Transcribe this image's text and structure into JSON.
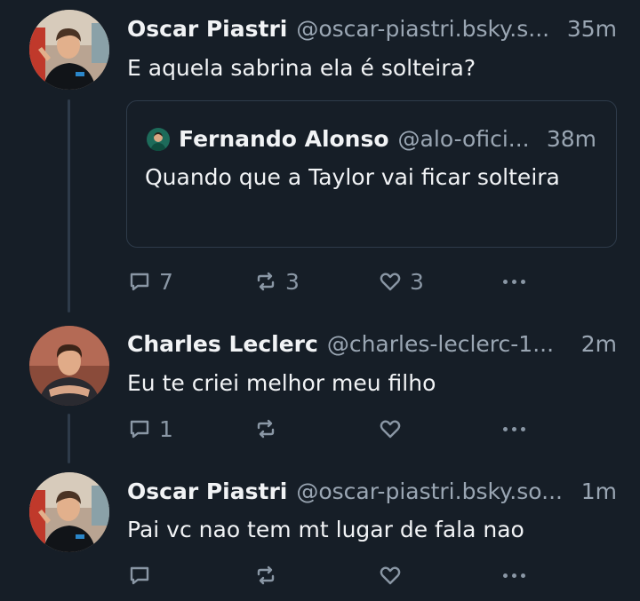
{
  "posts": [
    {
      "author_name": "Oscar Piastri",
      "author_handle": "@oscar-piastri.bsky.s...",
      "time": "35m",
      "text": "E aquela sabrina ela é solteira?",
      "avatar_icon": "avatar-oscar-photo",
      "quote": {
        "author_name": "Fernando Alonso",
        "author_handle": "@alo-ofici...",
        "time": "38m",
        "text": "Quando que a Taylor vai ficar solteira",
        "avatar_icon": "avatar-fernando-photo"
      },
      "replies": "7",
      "reposts": "3",
      "likes": "3"
    },
    {
      "author_name": "Charles Leclerc",
      "author_handle": "@charles-leclerc-1...",
      "time": "2m",
      "text": "Eu te criei melhor meu filho",
      "avatar_icon": "avatar-charles-photo",
      "replies": "1",
      "reposts": "",
      "likes": ""
    },
    {
      "author_name": "Oscar Piastri",
      "author_handle": "@oscar-piastri.bsky.so...",
      "time": "1m",
      "text": "Pai vc nao tem mt lugar de fala nao",
      "avatar_icon": "avatar-oscar-photo",
      "replies": "",
      "reposts": "",
      "likes": ""
    }
  ],
  "colors": {
    "background": "#161e27",
    "text": "#f1f3f5",
    "muted": "#9aa6b3",
    "border": "#2e3b4a"
  }
}
